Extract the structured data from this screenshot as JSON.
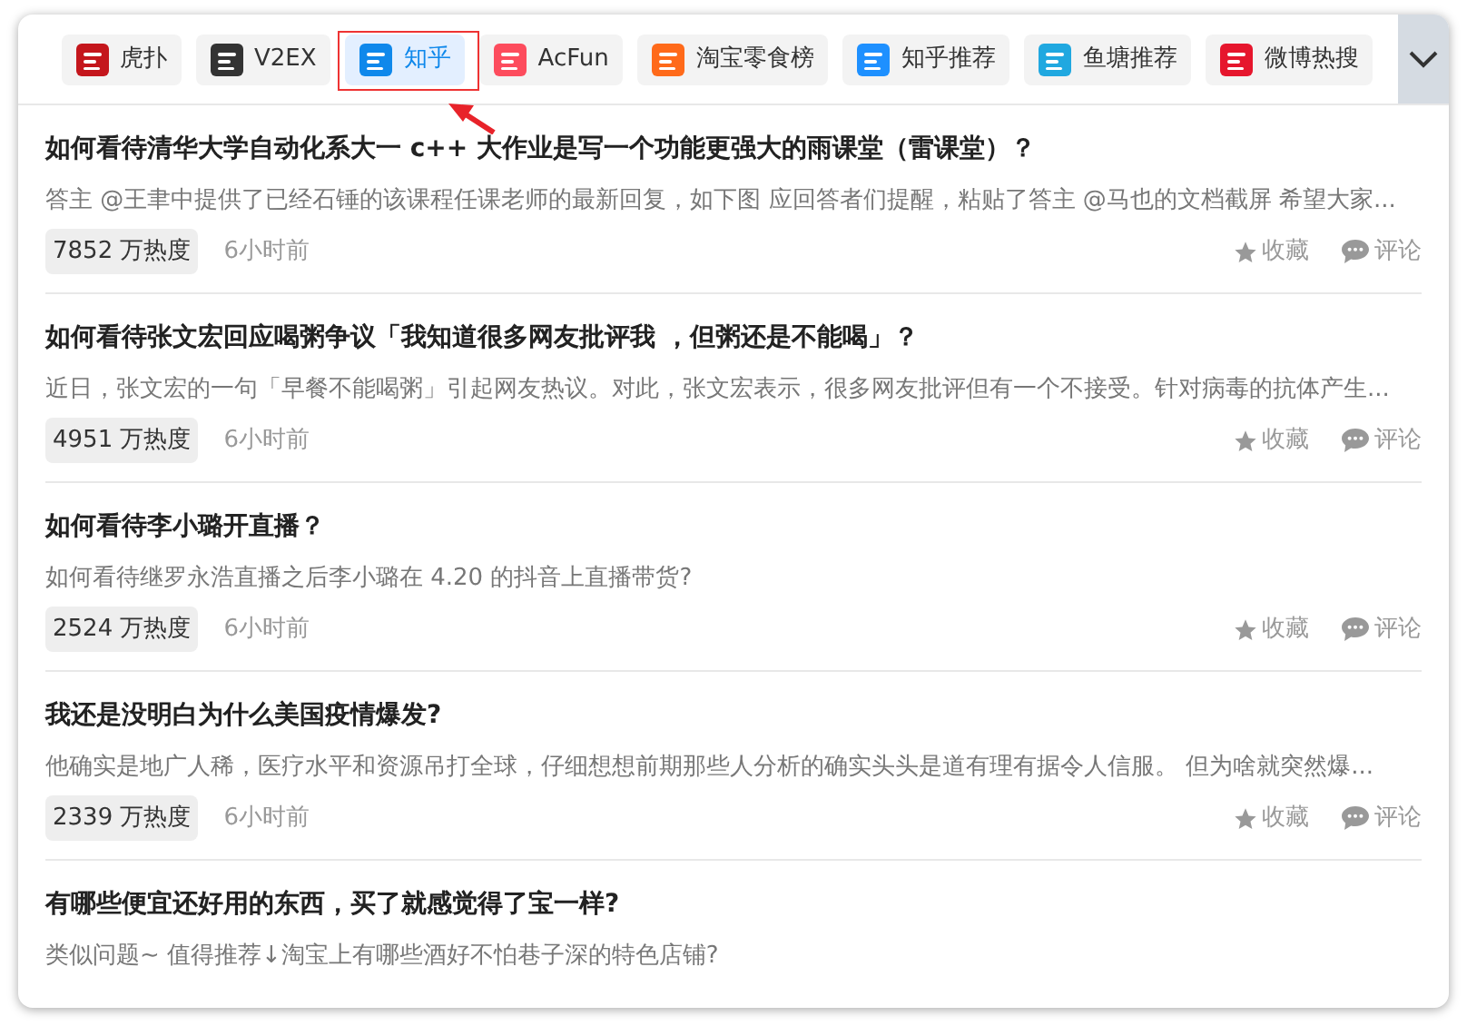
{
  "tabs": [
    {
      "label": "虎扑",
      "selected": false,
      "color": "#c4161c"
    },
    {
      "label": "V2EX",
      "selected": false,
      "color": "#333333"
    },
    {
      "label": "知乎",
      "selected": true,
      "color": "#0f88eb"
    },
    {
      "label": "AcFun",
      "selected": false,
      "color": "#fd4c5d"
    },
    {
      "label": "淘宝零食榜",
      "selected": false,
      "color": "#ff6a1a"
    },
    {
      "label": "知乎推荐",
      "selected": false,
      "color": "#1e90ff"
    },
    {
      "label": "鱼塘推荐",
      "selected": false,
      "color": "#20a8e0"
    },
    {
      "label": "微博热搜",
      "selected": false,
      "color": "#e6162d"
    }
  ],
  "items": [
    {
      "title": "如何看待清华大学自动化系大一 c++ 大作业是写一个功能更强大的雨课堂（雷课堂）？",
      "summary": "答主 @王聿中提供了已经石锤的该课程任课老师的最新回复，如下图 应回答者们提醒，粘贴了答主 @马也的文档截屏 希望大家...",
      "heat": "7852 万热度",
      "time": "6小时前",
      "favorite": "收藏",
      "comment": "评论"
    },
    {
      "title": "如何看待张文宏回应喝粥争议「我知道很多网友批评我 ，但粥还是不能喝」？",
      "summary": "近日，张文宏的一句「早餐不能喝粥」引起网友热议。对此，张文宏表示，很多网友批评但有一个不接受。针对病毒的抗体产生...",
      "heat": "4951 万热度",
      "time": "6小时前",
      "favorite": "收藏",
      "comment": "评论"
    },
    {
      "title": "如何看待李小璐开直播？",
      "summary": "如何看待继罗永浩直播之后李小璐在 4.20 的抖音上直播带货?",
      "heat": "2524 万热度",
      "time": "6小时前",
      "favorite": "收藏",
      "comment": "评论"
    },
    {
      "title": "我还是没明白为什么美国疫情爆发?",
      "summary": "他确实是地广人稀，医疗水平和资源吊打全球，仔细想想前期那些人分析的确实头头是道有理有据令人信服。 但为啥就突然爆...",
      "heat": "2339 万热度",
      "time": "6小时前",
      "favorite": "收藏",
      "comment": "评论"
    },
    {
      "title": "有哪些便宜还好用的东西，买了就感觉得了宝一样?",
      "summary": "类似问题~ 值得推荐↓淘宝上有哪些酒好不怕巷子深的特色店铺?"
    }
  ]
}
